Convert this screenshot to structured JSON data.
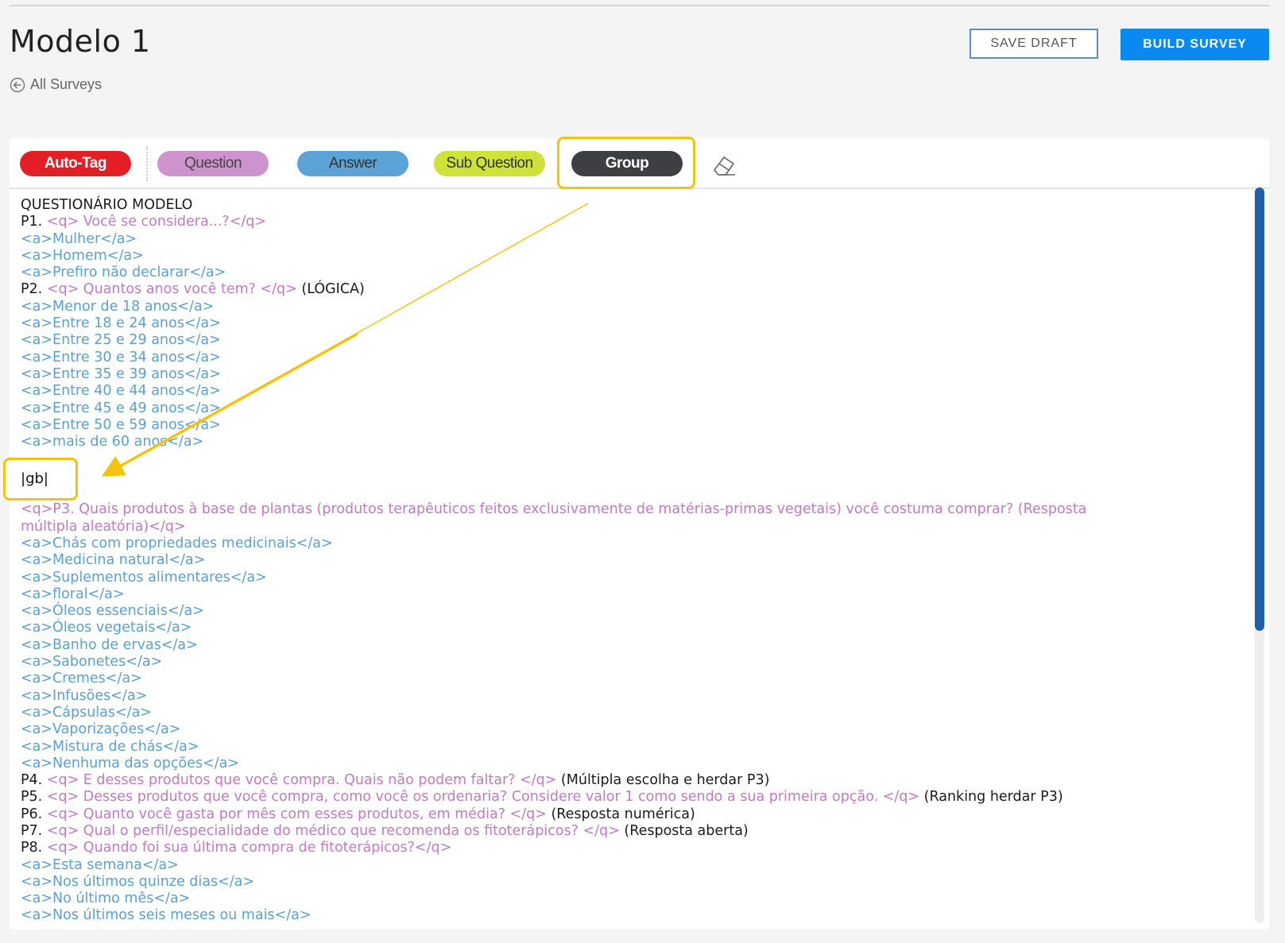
{
  "header": {
    "title": "Modelo 1",
    "back_label": "All Surveys",
    "save_draft": "SAVE DRAFT",
    "build_survey": "BUILD SURVEY"
  },
  "toolbar": {
    "auto_tag": "Auto-Tag",
    "question": "Question",
    "answer": "Answer",
    "sub_question": "Sub Question",
    "group": "Group"
  },
  "group_marker": "|gb|",
  "colors": {
    "question": "#c479c4",
    "answer": "#5aa0d6",
    "highlight": "#f5c30a",
    "primary": "#0a8af0"
  },
  "lines": [
    [
      {
        "t": "QUESTIONÁRIO MODELO",
        "c": "blk"
      }
    ],
    [
      {
        "t": "P1. ",
        "c": "blk"
      },
      {
        "t": "<q> Você se considera...?</q>",
        "c": "q"
      }
    ],
    [
      {
        "t": "<a>Mulher</a>",
        "c": "a"
      }
    ],
    [
      {
        "t": "<a>Homem</a>",
        "c": "a"
      }
    ],
    [
      {
        "t": "<a>Prefiro não declarar</a>",
        "c": "a"
      }
    ],
    [
      {
        "t": "P2. ",
        "c": "blk"
      },
      {
        "t": "<q> Quantos anos você tem? </q> ",
        "c": "q"
      },
      {
        "t": "(LÓGICA)",
        "c": "blk"
      }
    ],
    [
      {
        "t": "<a>Menor de 18 anos</a>",
        "c": "a"
      }
    ],
    [
      {
        "t": "<a>Entre 18 e 24 anos</a>",
        "c": "a"
      }
    ],
    [
      {
        "t": "<a>Entre 25 e 29 anos</a>",
        "c": "a"
      }
    ],
    [
      {
        "t": "<a>Entre 30 e 34 anos</a>",
        "c": "a"
      }
    ],
    [
      {
        "t": "<a>Entre 35 e 39 anos</a>",
        "c": "a"
      }
    ],
    [
      {
        "t": "<a>Entre 40 e 44 anos</a>",
        "c": "a"
      }
    ],
    [
      {
        "t": "<a>Entre 45 e 49 anos</a>",
        "c": "a"
      }
    ],
    [
      {
        "t": "<a>Entre 50 e 59 anos</a>",
        "c": "a"
      }
    ],
    [
      {
        "t": "<a>mais de 60 anos</a>",
        "c": "a"
      }
    ],
    [],
    [],
    [],
    [
      {
        "t": "<q>P3. Quais produtos à base de plantas (produtos terapêuticos feitos exclusivamente de matérias-primas vegetais) você costuma comprar? (Resposta",
        "c": "q"
      }
    ],
    [
      {
        "t": "múltipla aleatória)</q>",
        "c": "q"
      }
    ],
    [
      {
        "t": "<a>Chás com propriedades medicinais</a>",
        "c": "a"
      }
    ],
    [
      {
        "t": "<a>Medicina natural</a>",
        "c": "a"
      }
    ],
    [
      {
        "t": "<a>Suplementos alimentares</a>",
        "c": "a"
      }
    ],
    [
      {
        "t": "<a>floral</a>",
        "c": "a"
      }
    ],
    [
      {
        "t": "<a>Óleos essenciais</a>",
        "c": "a"
      }
    ],
    [
      {
        "t": "<a>Óleos vegetais</a>",
        "c": "a"
      }
    ],
    [
      {
        "t": "<a>Banho de ervas</a>",
        "c": "a"
      }
    ],
    [
      {
        "t": "<a>Sabonetes</a>",
        "c": "a"
      }
    ],
    [
      {
        "t": "<a>Cremes</a>",
        "c": "a"
      }
    ],
    [
      {
        "t": "<a>Infusões</a>",
        "c": "a"
      }
    ],
    [
      {
        "t": "<a>Cápsulas</a>",
        "c": "a"
      }
    ],
    [
      {
        "t": "<a>Vaporizações</a>",
        "c": "a"
      }
    ],
    [
      {
        "t": "<a>Mistura de chás</a>",
        "c": "a"
      }
    ],
    [
      {
        "t": "<a>Nenhuma das opções</a>",
        "c": "a"
      }
    ],
    [
      {
        "t": "P4. ",
        "c": "blk"
      },
      {
        "t": "<q> E desses produtos que você compra. Quais não podem faltar? </q> ",
        "c": "q"
      },
      {
        "t": "(Múltipla escolha e herdar P3)",
        "c": "blk"
      }
    ],
    [
      {
        "t": "P5. ",
        "c": "blk"
      },
      {
        "t": "<q> Desses produtos que você compra, como você os ordenaria? Considere valor 1 como sendo a sua primeira opção. </q> ",
        "c": "q"
      },
      {
        "t": "(Ranking herdar P3)",
        "c": "blk"
      }
    ],
    [
      {
        "t": "P6. ",
        "c": "blk"
      },
      {
        "t": "<q> Quanto você gasta por mês com esses produtos, em média? </q> ",
        "c": "q"
      },
      {
        "t": "(Resposta numérica)",
        "c": "blk"
      }
    ],
    [
      {
        "t": "P7. ",
        "c": "blk"
      },
      {
        "t": "<q> Qual o perfil/especialidade do médico que recomenda os fitoterápicos? </q> ",
        "c": "q"
      },
      {
        "t": "(Resposta aberta)",
        "c": "blk"
      }
    ],
    [
      {
        "t": "P8. ",
        "c": "blk"
      },
      {
        "t": "<q> Quando foi sua última compra de fitoterápicos?</q>",
        "c": "q"
      }
    ],
    [
      {
        "t": "<a>Esta semana</a>",
        "c": "a"
      }
    ],
    [
      {
        "t": "<a>Nos últimos quinze dias</a>",
        "c": "a"
      }
    ],
    [
      {
        "t": "<a>No último mês</a>",
        "c": "a"
      }
    ],
    [
      {
        "t": "<a>Nos últimos seis meses ou mais</a>",
        "c": "a"
      }
    ]
  ]
}
